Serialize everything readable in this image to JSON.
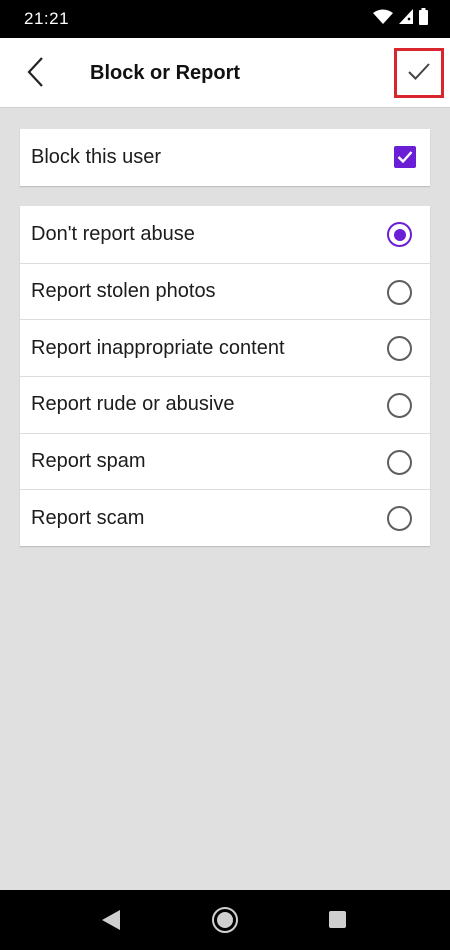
{
  "status_bar": {
    "time": "21:21",
    "icons": [
      "wifi-icon",
      "signal-icon",
      "battery-icon"
    ]
  },
  "app_bar": {
    "title": "Block or Report",
    "back_icon": "chevron-left-icon",
    "confirm_icon": "check-icon",
    "confirm_highlight_color": "#d9262e"
  },
  "block_option": {
    "label": "Block this user",
    "checked": true
  },
  "report_options": [
    {
      "label": "Don't report abuse",
      "selected": true
    },
    {
      "label": "Report stolen photos",
      "selected": false
    },
    {
      "label": "Report inappropriate content",
      "selected": false
    },
    {
      "label": "Report rude or abusive",
      "selected": false
    },
    {
      "label": "Report spam",
      "selected": false
    },
    {
      "label": "Report scam",
      "selected": false
    }
  ],
  "nav_bar": {
    "icons": [
      "nav-back-icon",
      "nav-home-icon",
      "nav-recents-icon"
    ]
  },
  "colors": {
    "accent": "#6a1ed6",
    "background": "#e0e0e0"
  }
}
